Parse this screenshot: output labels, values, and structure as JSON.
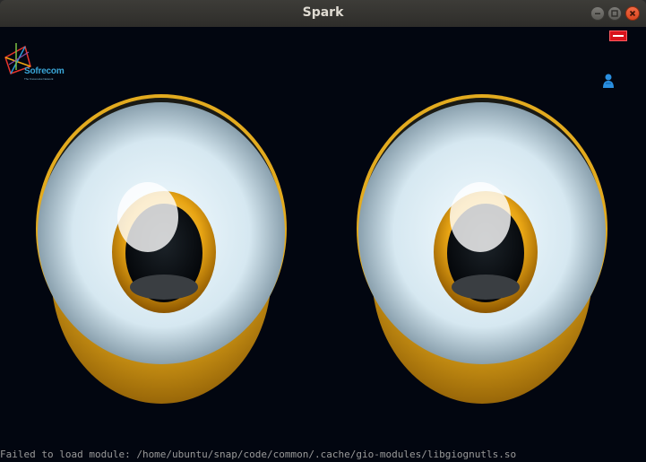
{
  "window": {
    "title": "Spark",
    "controls": [
      "minimize-icon",
      "maximize-icon",
      "close-icon"
    ]
  },
  "logo": {
    "name": "Sofrecom",
    "tagline": "The Know-How Network"
  },
  "toolbar": {
    "minus_icon": "minus-icon",
    "user_icon": "user-icon"
  },
  "terminal": {
    "text": "Failed to load module: /home/ubuntu/snap/code/common/.cache/gio-modules/libgiognutls.so"
  },
  "colors": {
    "background": "#020610",
    "eye_rim": "#e3a81a",
    "sclera": "#d8eaf2",
    "pupil": "#05090e",
    "minus_button": "#d8131c",
    "logo_text": "#3aa6d8"
  }
}
